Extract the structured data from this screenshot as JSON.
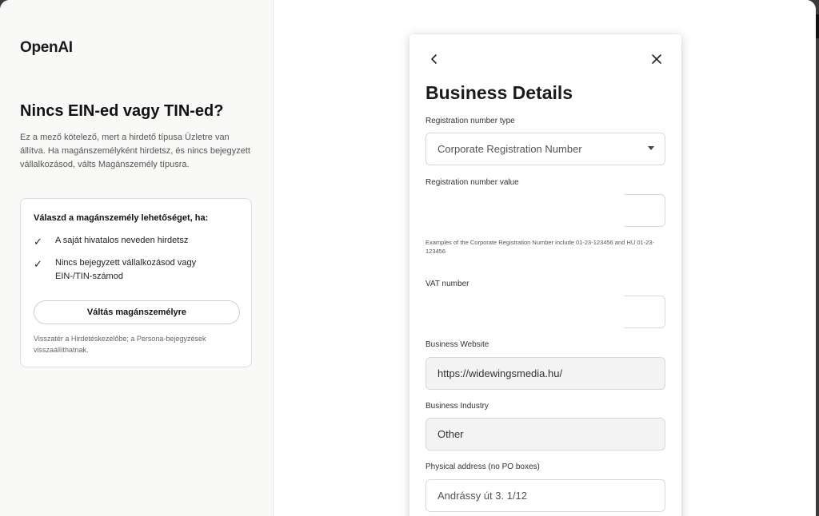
{
  "left": {
    "logo": "OpenAI",
    "headline": "Nincs EIN-ed vagy TIN-ed?",
    "description": "Ez a mező kötelező, mert a hirdető típusa Üzletre van állítva. Ha magánszemélyként hirdetsz, és nincs bejegyzett vállalkozásod, válts Magánszemély típusra.",
    "card": {
      "title": "Válaszd a magánszemély lehetőséget, ha:",
      "items": [
        "A saját hivatalos neveden hirdetsz",
        "Nincs bejegyzett vállalkozásod vagy EIN-/TIN-számod"
      ],
      "button_label": "Váltás magánszemélyre",
      "note": "Visszatér a Hirdetéskezelőbe; a Persona-bejegyzések visszaállíthatnak."
    }
  },
  "modal": {
    "title": "Business Details",
    "fields": {
      "reg_type": {
        "label": "Registration number type",
        "value": "Corporate Registration Number"
      },
      "reg_value": {
        "label": "Registration number value",
        "value": ""
      },
      "helper": "Examples of the Corporate Registration Number include 01-23-123456 and HU 01-23-123456",
      "vat": {
        "label": "VAT number",
        "value": ""
      },
      "website": {
        "label": "Business Website",
        "value": "https://widewingsmedia.hu/"
      },
      "industry": {
        "label": "Business Industry",
        "value": "Other"
      },
      "address": {
        "label": "Physical address (no PO boxes)",
        "value": "Andrássy út 3. 1/12"
      }
    }
  },
  "icons": {
    "back": "chevron-left-icon",
    "close": "close-icon",
    "check": "checkmark-icon",
    "caret": "caret-down-icon"
  },
  "colors": {
    "left_background": "#f9f9f8",
    "filled_input_background": "#f3f3f3"
  }
}
